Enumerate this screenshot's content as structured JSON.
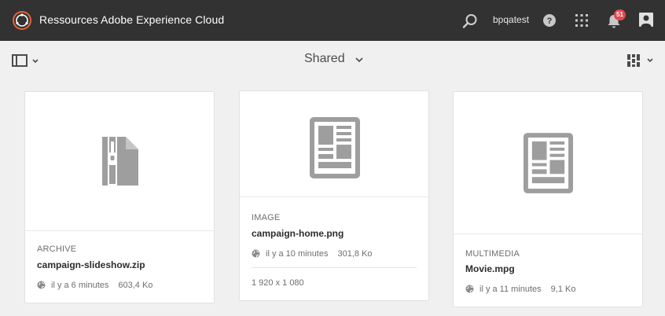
{
  "shell": {
    "brand": "Ressources Adobe Experience Cloud",
    "user": "bpqatest",
    "notification_count": "51",
    "icons": [
      "adobe-logo-icon",
      "search-icon",
      "help-icon",
      "apps-grid-icon",
      "bell-icon",
      "user-profile-icon"
    ]
  },
  "actionbar": {
    "title": "Shared"
  },
  "cards": [
    {
      "type": "ARCHIVE",
      "name": "campaign-slideshow.zip",
      "modified": "il y a 6 minutes",
      "size": "603,4 Ko",
      "icon": "archive-file-icon"
    },
    {
      "type": "IMAGE",
      "name": "campaign-home.png",
      "modified": "il y a 10 minutes",
      "size": "301,8 Ko",
      "dimensions": "1 920 x 1 080",
      "icon": "document-layout-icon"
    },
    {
      "type": "MULTIMEDIA",
      "name": "Movie.mpg",
      "modified": "il y a 11 minutes",
      "size": "9,1 Ko",
      "icon": "document-layout-icon"
    }
  ]
}
